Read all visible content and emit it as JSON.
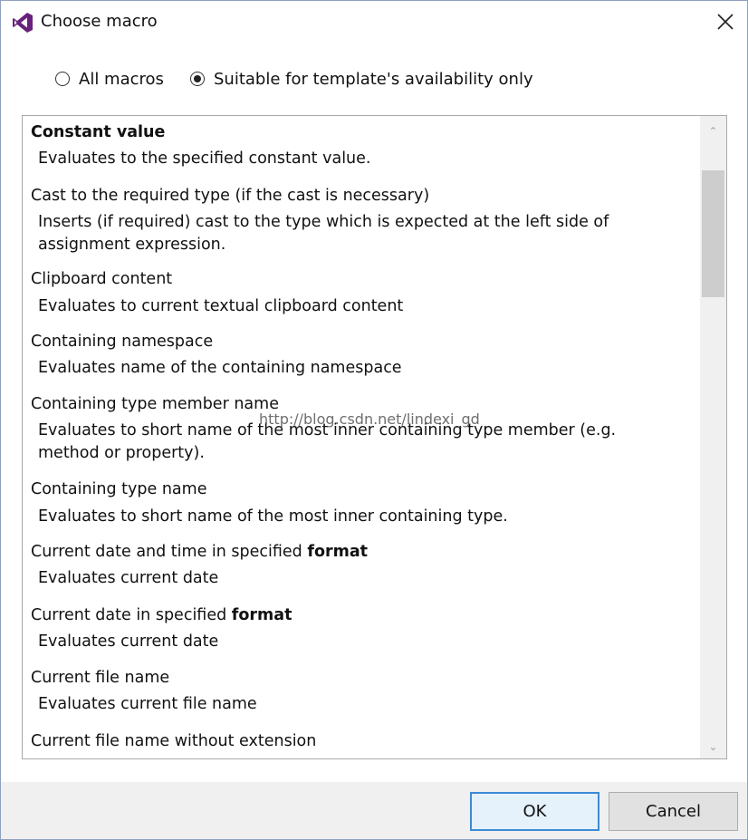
{
  "window": {
    "title": "Choose macro"
  },
  "radios": [
    {
      "label": "All macros",
      "checked": false
    },
    {
      "label": "Suitable for template's availability only",
      "checked": true
    }
  ],
  "macros": [
    {
      "name_parts": [
        {
          "text": "Constant value",
          "bold": true
        }
      ],
      "desc": "Evaluates to the specified constant value."
    },
    {
      "name_parts": [
        {
          "text": "Cast to the required type (if the cast is necessary)",
          "bold": false
        }
      ],
      "desc": "Inserts (if required) cast to the type which is expected at the left side of assignment expression."
    },
    {
      "name_parts": [
        {
          "text": "Clipboard content",
          "bold": false
        }
      ],
      "desc": "Evaluates to current textual clipboard content"
    },
    {
      "name_parts": [
        {
          "text": "Containing namespace",
          "bold": false
        }
      ],
      "desc": "Evaluates name of the containing namespace"
    },
    {
      "name_parts": [
        {
          "text": "Containing type member name",
          "bold": false
        }
      ],
      "desc": "Evaluates to short name of the most inner containing type member (e.g. method or property)."
    },
    {
      "name_parts": [
        {
          "text": "Containing type name",
          "bold": false
        }
      ],
      "desc": "Evaluates to short name of the most inner containing type."
    },
    {
      "name_parts": [
        {
          "text": "Current date and time in specified ",
          "bold": false
        },
        {
          "text": "format",
          "bold": true
        }
      ],
      "desc": "Evaluates current date"
    },
    {
      "name_parts": [
        {
          "text": "Current date in specified ",
          "bold": false
        },
        {
          "text": "format",
          "bold": true
        }
      ],
      "desc": "Evaluates current date"
    },
    {
      "name_parts": [
        {
          "text": "Current file name",
          "bold": false
        }
      ],
      "desc": "Evaluates current file name"
    },
    {
      "name_parts": [
        {
          "text": "Current file name without extension",
          "bold": false
        }
      ],
      "desc": ""
    }
  ],
  "watermark": "http://blog.csdn.net/lindexi_gd",
  "buttons": {
    "ok": "OK",
    "cancel": "Cancel"
  },
  "colors": {
    "accent": "#3c8ad6",
    "icon_purple": "#68217a"
  }
}
